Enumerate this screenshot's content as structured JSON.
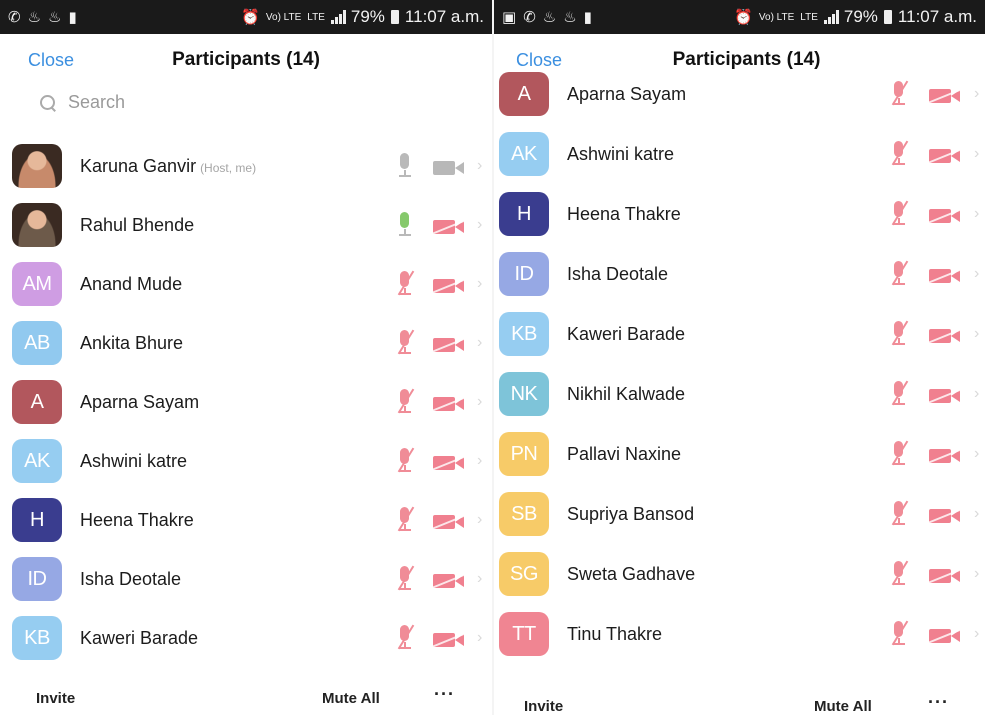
{
  "status_bar": {
    "left": {
      "app_icons": [
        "whatsapp-icon",
        "flame-icon",
        "flame-icon",
        "video-icon"
      ],
      "right_icons": [
        "image-icon",
        "whatsapp-icon",
        "flame-icon",
        "flame-icon",
        "video-icon"
      ]
    },
    "alarm_icon": "alarm-icon",
    "volte": "Vo) LTE",
    "lte": "LTE",
    "battery": "79%",
    "time": "11:07 a.m."
  },
  "header": {
    "close_label": "Close",
    "title": "Participants (14)"
  },
  "search": {
    "placeholder": "Search"
  },
  "host_tag": "(Host, me)",
  "left_panel": {
    "participants": [
      {
        "name": "Karuna Ganvir",
        "host": true,
        "initials": "",
        "color": "#c78a6b",
        "mic": "off",
        "video": "off",
        "photo": true
      },
      {
        "name": "Rahul Bhende",
        "host": false,
        "initials": "",
        "color": "#6d5a4a",
        "mic": "live",
        "video": "muted",
        "photo": true
      },
      {
        "name": "Anand Mude",
        "initials": "AM",
        "color": "#cf9de3",
        "mic": "muted",
        "video": "muted"
      },
      {
        "name": "Ankita Bhure",
        "initials": "AB",
        "color": "#91c9ef",
        "mic": "muted",
        "video": "muted"
      },
      {
        "name": "Aparna Sayam",
        "initials": "A",
        "color": "#b2575d",
        "mic": "muted",
        "video": "muted"
      },
      {
        "name": "Ashwini katre",
        "initials": "AK",
        "color": "#96cdf1",
        "mic": "muted",
        "video": "muted"
      },
      {
        "name": "Heena Thakre",
        "initials": "H",
        "color": "#3a3d8f",
        "mic": "muted",
        "video": "muted"
      },
      {
        "name": "Isha Deotale",
        "initials": "ID",
        "color": "#96a8e4",
        "mic": "muted",
        "video": "muted"
      },
      {
        "name": "Kaweri Barade",
        "initials": "KB",
        "color": "#96cdf1",
        "mic": "muted",
        "video": "muted"
      }
    ]
  },
  "right_panel": {
    "participants": [
      {
        "name": "Aparna Sayam",
        "initials": "A",
        "color": "#b2575d",
        "mic": "muted",
        "video": "muted"
      },
      {
        "name": "Ashwini katre",
        "initials": "AK",
        "color": "#96cdf1",
        "mic": "muted",
        "video": "muted"
      },
      {
        "name": "Heena Thakre",
        "initials": "H",
        "color": "#3a3d8f",
        "mic": "muted",
        "video": "muted"
      },
      {
        "name": "Isha Deotale",
        "initials": "ID",
        "color": "#96a8e4",
        "mic": "muted",
        "video": "muted"
      },
      {
        "name": "Kaweri Barade",
        "initials": "KB",
        "color": "#96cdf1",
        "mic": "muted",
        "video": "muted"
      },
      {
        "name": "Nikhil Kalwade",
        "initials": "NK",
        "color": "#7ec4d9",
        "mic": "muted",
        "video": "muted"
      },
      {
        "name": "Pallavi Naxine",
        "initials": "PN",
        "color": "#f7cb68",
        "mic": "muted",
        "video": "muted"
      },
      {
        "name": "Supriya Bansod",
        "initials": "SB",
        "color": "#f7cb68",
        "mic": "muted",
        "video": "muted"
      },
      {
        "name": "Sweta Gadhave",
        "initials": "SG",
        "color": "#f7cb68",
        "mic": "muted",
        "video": "muted"
      },
      {
        "name": "Tinu Thakre",
        "initials": "TT",
        "color": "#f08592",
        "mic": "muted",
        "video": "muted"
      }
    ]
  },
  "footer": {
    "invite_label": "Invite",
    "mute_all_label": "Mute All",
    "more_label": "···"
  }
}
